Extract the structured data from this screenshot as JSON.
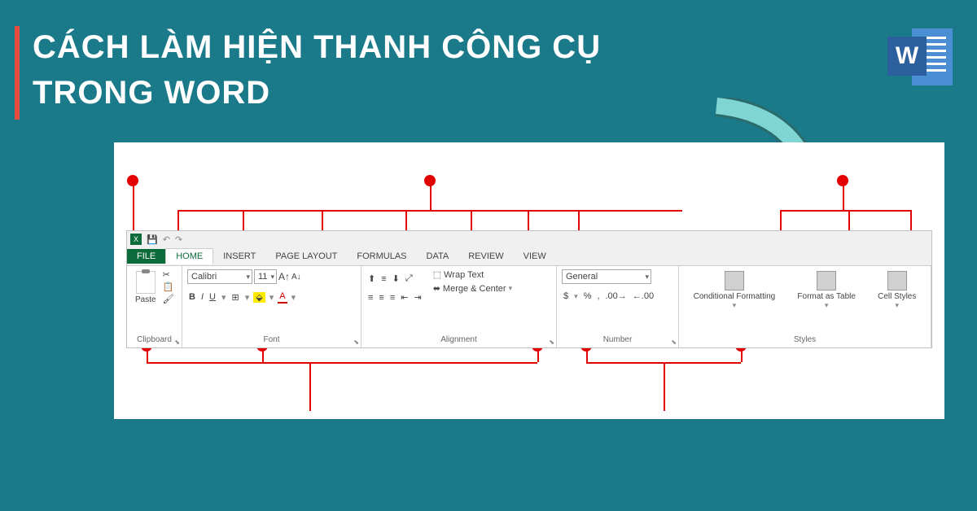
{
  "title_line1": "CÁCH LÀM HIỆN THANH CÔNG CỤ",
  "title_line2": "TRONG WORD",
  "word_badge": "W",
  "tabs": {
    "file": "FILE",
    "home": "HOME",
    "insert": "INSERT",
    "page_layout": "PAGE LAYOUT",
    "formulas": "FORMULAS",
    "data": "DATA",
    "review": "REVIEW",
    "view": "VIEW"
  },
  "clipboard": {
    "paste": "Paste",
    "label": "Clipboard"
  },
  "font": {
    "name": "Calibri",
    "size": "11",
    "label": "Font"
  },
  "alignment": {
    "wrap": "Wrap Text",
    "merge": "Merge & Center",
    "label": "Alignment"
  },
  "number": {
    "format": "General",
    "currency": "$",
    "percent": "%",
    "comma": ",",
    "label": "Number"
  },
  "styles": {
    "conditional": "Conditional Formatting",
    "format_table": "Format as Table",
    "cell_styles": "Cell Styles",
    "label": "Styles"
  }
}
